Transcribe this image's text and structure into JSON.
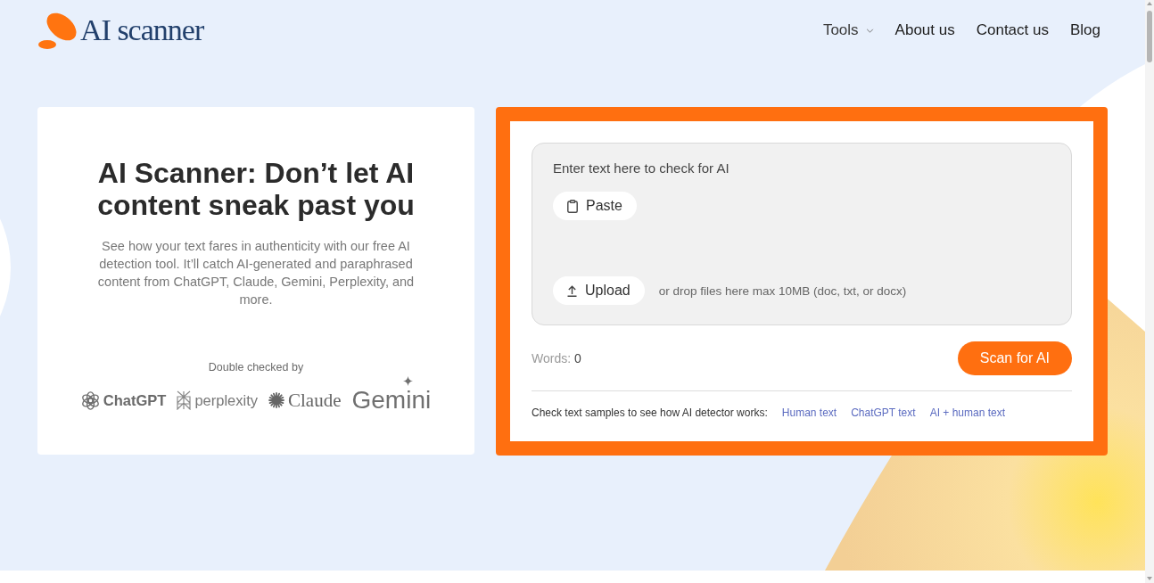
{
  "header": {
    "logo_text": "AI scanner",
    "nav": [
      {
        "label": "Tools",
        "kind": "dropdown"
      },
      {
        "label": "About us",
        "kind": "link"
      },
      {
        "label": "Contact us",
        "kind": "link"
      },
      {
        "label": "Blog",
        "kind": "link"
      }
    ]
  },
  "intro": {
    "title": "AI Scanner: Don’t let AI content sneak past you",
    "description": "See how your text fares in authenticity with our free AI detection tool. It’ll catch AI-generated and paraphrased content from ChatGPT, Claude, Gemini, Perplexity, and more.",
    "checked_by": "Double checked by",
    "logos": [
      {
        "name": "ChatGPT",
        "kind": "chatgpt"
      },
      {
        "name": "perplexity",
        "kind": "perplexity"
      },
      {
        "name": "Claude",
        "kind": "claude"
      },
      {
        "name": "Gemini",
        "kind": "gemini"
      }
    ]
  },
  "scanner": {
    "input": {
      "placeholder": "Enter text here to check for AI"
    },
    "paste_button": "Paste",
    "upload_button": "Upload",
    "drop_hint": "or drop files here max 10MB (doc, txt, or docx)",
    "words_label": "Words:",
    "words_count": "0",
    "scan_button": "Scan for AI",
    "samples_prompt": "Check text samples to see how AI detector works:",
    "sample_links": [
      "Human text",
      "ChatGPT text",
      "AI + human text"
    ]
  }
}
